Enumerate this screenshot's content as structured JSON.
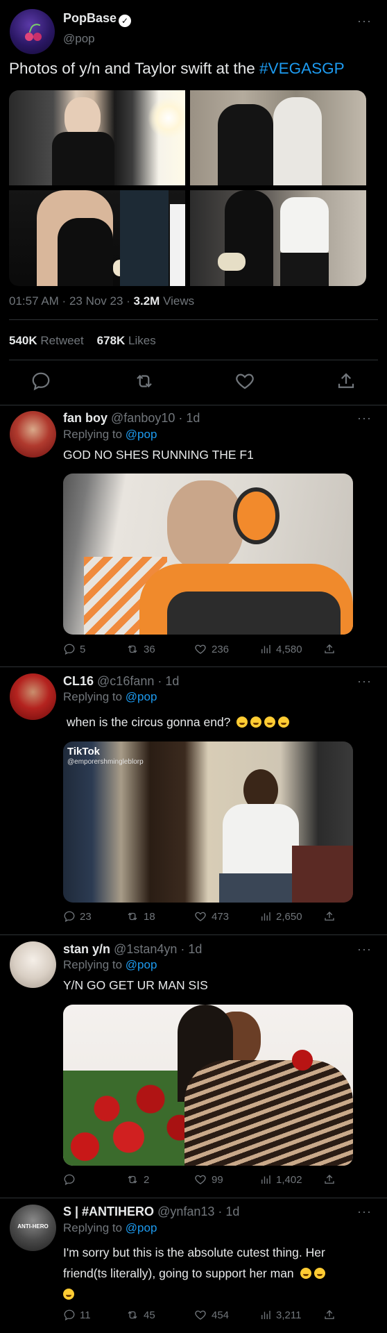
{
  "main": {
    "name": "PopBase",
    "handle": "@pop",
    "text": "Photos of y/n and Taylor swift at the ",
    "hashtag": "#VEGASGP",
    "meta": {
      "time": "01:57 AM",
      "date": "23 Nov 23",
      "views_count": "3.2M",
      "views_label": "Views"
    },
    "retweets": {
      "count": "540K",
      "label": "Retweet"
    },
    "likes": {
      "count": "678K",
      "label": "Likes"
    }
  },
  "replies": [
    {
      "name": "fan boy",
      "handle": "@fanboy10",
      "age": "1d",
      "replying_label": "Replying to",
      "replying_to": "@pop",
      "text": "GOD NO SHES RUNNING THE F1",
      "stats": {
        "replies": "5",
        "retweets": "36",
        "likes": "236",
        "views": "4,580"
      }
    },
    {
      "name": "CL16",
      "handle": "@c16fann",
      "age": "1d",
      "replying_label": "Replying to",
      "replying_to": "@pop",
      "text": "when is the circus gonna end?",
      "media_watermark": "TikTok",
      "media_user": "@emporershmingleblorp",
      "stats": {
        "replies": "23",
        "retweets": "18",
        "likes": "473",
        "views": "2,650"
      }
    },
    {
      "name": "stan y/n",
      "handle": "@1stan4yn",
      "age": "1d",
      "replying_label": "Replying to",
      "replying_to": "@pop",
      "text": "Y/N GO GET UR MAN SIS",
      "stats": {
        "replies": "",
        "retweets": "2",
        "likes": "99",
        "views": "1,402"
      }
    },
    {
      "name": "S | #ANTIHERO",
      "handle": "@ynfan13",
      "age": "1d",
      "replying_label": "Replying to",
      "replying_to": "@pop",
      "avatar_text": "ANTI-HERO",
      "text_line1": "I'm sorry but this is the absolute cutest thing. Her",
      "text_line2": "friend(ts literally), going to support her man",
      "stats": {
        "replies": "11",
        "retweets": "45",
        "likes": "454",
        "views": "3,211"
      }
    }
  ],
  "colors": {
    "background": "#000000",
    "text": "#e7e9ea",
    "muted": "#71767b",
    "link": "#1d9bf0",
    "divider": "#2f3336"
  }
}
